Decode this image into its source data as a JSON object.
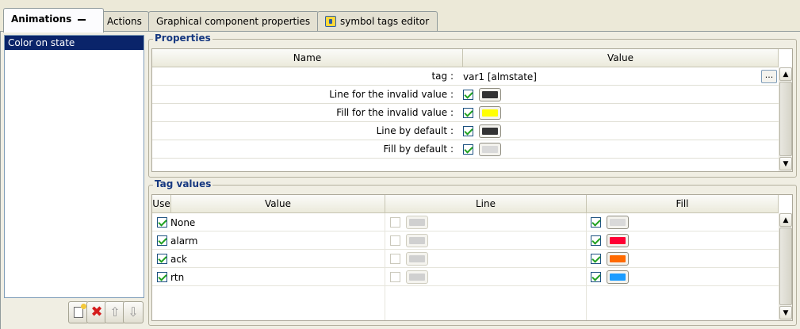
{
  "tabs": [
    {
      "label": "Animations",
      "active": true
    },
    {
      "label": "Actions",
      "active": false
    },
    {
      "label": "Graphical component properties",
      "active": false
    },
    {
      "label": "symbol tags editor",
      "active": false
    }
  ],
  "animations_list": {
    "items": [
      "Color on state"
    ],
    "selected": "Color on state"
  },
  "properties": {
    "legend": "Properties",
    "col_name": "Name",
    "col_value": "Value",
    "tag_label": "tag :",
    "tag_value": "var1 [almstate]",
    "ellipsis": "...",
    "rows": [
      {
        "label": "Line for the invalid value :",
        "checked": true,
        "color": "#333333"
      },
      {
        "label": "Fill for the invalid value :",
        "checked": true,
        "color": "#ffff00"
      },
      {
        "label": "Line by default :",
        "checked": true,
        "color": "#333333"
      },
      {
        "label": "Fill by default :",
        "checked": true,
        "color": "#d9d9d9"
      }
    ]
  },
  "tag_values": {
    "legend": "Tag values",
    "col_use": "Use",
    "col_value": "Value",
    "col_line": "Line",
    "col_fill": "Fill",
    "rows": [
      {
        "use": true,
        "value": "None",
        "line_checked": false,
        "line_color": "#d0d0d0",
        "fill_checked": true,
        "fill_color": "#d9d9d9"
      },
      {
        "use": true,
        "value": "alarm",
        "line_checked": false,
        "line_color": "#d0d0d0",
        "fill_checked": true,
        "fill_color": "#ff0033"
      },
      {
        "use": true,
        "value": "ack",
        "line_checked": false,
        "line_color": "#d0d0d0",
        "fill_checked": true,
        "fill_color": "#ff6a00"
      },
      {
        "use": true,
        "value": "rtn",
        "line_checked": false,
        "line_color": "#d0d0d0",
        "fill_checked": true,
        "fill_color": "#1a9cff"
      }
    ]
  },
  "icons": {
    "new": "new-animation-icon",
    "delete": "delete-icon",
    "up": "move-up-icon",
    "down": "move-down-icon",
    "tag": "tag-editor-icon"
  }
}
